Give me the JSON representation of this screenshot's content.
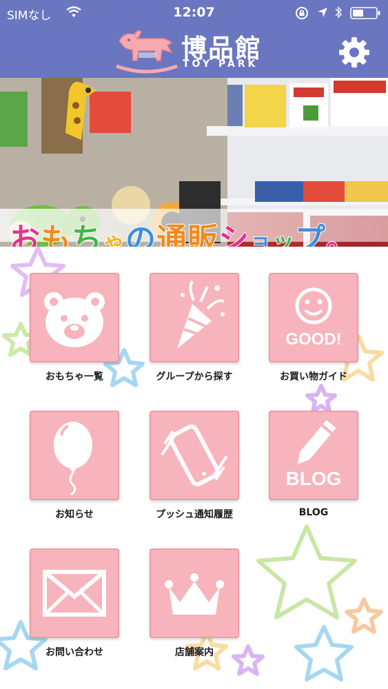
{
  "status_bar": {
    "carrier": "SIMなし",
    "time": "12:07"
  },
  "header": {
    "brand_jp": "博品館",
    "brand_en": "TOY PARK"
  },
  "banner": {
    "title_chars": [
      "お",
      "も",
      "ち",
      "ゃ",
      "の",
      "通",
      "販",
      "シ",
      "ョ",
      "ッ",
      "プ",
      "。"
    ]
  },
  "menu": {
    "items": [
      {
        "label": "おもちゃ一覧",
        "icon": "bear-icon"
      },
      {
        "label": "グループから探す",
        "icon": "party-popper-icon"
      },
      {
        "label": "お買い物ガイド",
        "icon": "smiley-good-icon",
        "icon_text": "GOOD!"
      },
      {
        "label": "お知らせ",
        "icon": "balloon-icon"
      },
      {
        "label": "プッシュ通知履歴",
        "icon": "vibrating-phone-icon"
      },
      {
        "label": "BLOG",
        "icon": "pencil-blog-icon",
        "icon_text": "BLOG"
      },
      {
        "label": "お問い合わせ",
        "icon": "envelope-icon"
      },
      {
        "label": "店舗案内",
        "icon": "crown-icon"
      }
    ]
  },
  "colors": {
    "header_bg": "#6a76bf",
    "tile_bg": "#f7b4bc",
    "tile_border": "#f19aa6"
  }
}
